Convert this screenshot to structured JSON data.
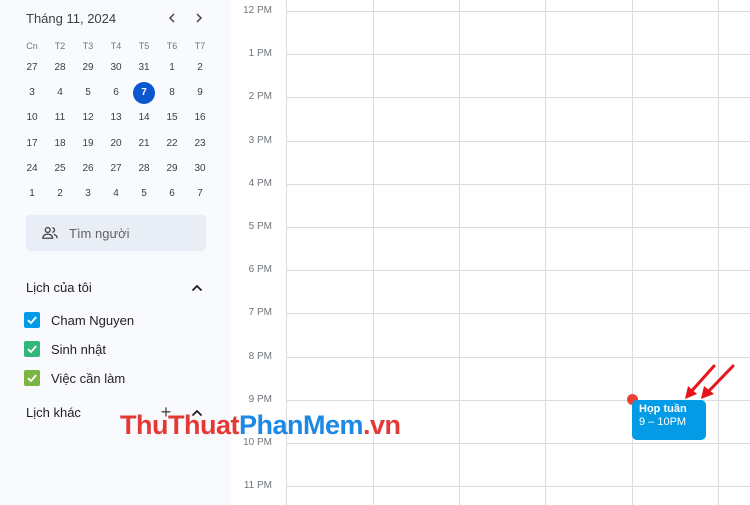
{
  "mini_calendar": {
    "month_title": "Tháng 11, 2024",
    "weekdays": [
      "Cn",
      "T2",
      "T3",
      "T4",
      "T5",
      "T6",
      "T7"
    ],
    "weeks": [
      [
        "27",
        "28",
        "29",
        "30",
        "31",
        "1",
        "2"
      ],
      [
        "3",
        "4",
        "5",
        "6",
        "7",
        "8",
        "9"
      ],
      [
        "10",
        "11",
        "12",
        "13",
        "14",
        "15",
        "16"
      ],
      [
        "17",
        "18",
        "19",
        "20",
        "21",
        "22",
        "23"
      ],
      [
        "24",
        "25",
        "26",
        "27",
        "28",
        "29",
        "30"
      ],
      [
        "1",
        "2",
        "3",
        "4",
        "5",
        "6",
        "7"
      ]
    ],
    "today": "7"
  },
  "search_people": {
    "label": "Tìm người"
  },
  "my_calendars": {
    "title": "Lịch của tôi",
    "items": [
      {
        "label": "Cham Nguyen",
        "color": "#039be5"
      },
      {
        "label": "Sinh nhật",
        "color": "#33b679"
      },
      {
        "label": "Việc cần làm",
        "color": "#7cb342"
      }
    ]
  },
  "other_calendars": {
    "title": "Lịch khác"
  },
  "time_grid": {
    "hours": [
      "12 PM",
      "1 PM",
      "2 PM",
      "3 PM",
      "4 PM",
      "5 PM",
      "6 PM",
      "7 PM",
      "8 PM",
      "9 PM",
      "10 PM",
      "11 PM"
    ]
  },
  "event": {
    "title": "Họp tuần",
    "time": "9 – 10PM",
    "color": "#039be5"
  },
  "watermark": {
    "part1": "ThuThuat",
    "part2": "PhanMem",
    "part3": ".vn"
  },
  "colors": {
    "today": "#0b57d0",
    "current_time": "#ea4335",
    "arrow": "#e8141c"
  }
}
